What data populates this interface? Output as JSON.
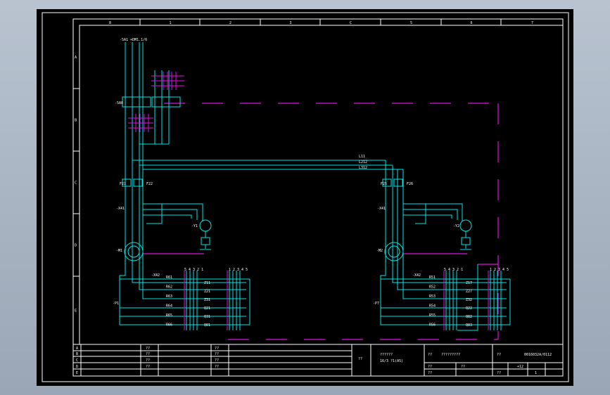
{
  "colors": {
    "background": "#000000",
    "frame": "#ffffff",
    "wire": "#00e5e5",
    "magenta": "#e010e0",
    "label": "#ffffff"
  },
  "column_markers": [
    "8",
    "1",
    "2",
    "3",
    "C",
    "5",
    "6",
    "7"
  ],
  "row_markers": [
    "A",
    "B",
    "C",
    "D",
    "E"
  ],
  "schematic": {
    "supply_ref": "-5A1 +DM1.1/6",
    "phase_labels": [
      "L1",
      "L2",
      "L3"
    ],
    "switch_ref": "-5A0",
    "switch_contacts": [
      "1",
      "3",
      "5"
    ],
    "switch_row2": [
      "B7",
      "B1",
      "B1",
      "B2"
    ],
    "bus_labels": [
      "L11",
      "L212",
      "L312"
    ],
    "left_fuses": [
      "F21",
      "F22"
    ],
    "right_fuses": [
      "F25",
      "F26"
    ],
    "left_terminal": "-X41",
    "right_terminal": "-X41",
    "left_valve": "-Y1",
    "right_valve": "-Y2",
    "left_motor": "-M1",
    "right_motor": "-M2",
    "left_terminal_block": "-X42",
    "right_terminal_block": "-X42",
    "left_block_numbers": "5 4 3 2 1",
    "right_block_numbers": "5 4 3 2 1",
    "left_block2_numbers": "1 2 3 4 5",
    "right_block2_numbers": "1 2 3 4 5",
    "left_R_labels": [
      "R61",
      "R62",
      "R63",
      "R64",
      "R65",
      "R66"
    ],
    "right_R_labels": [
      "R51",
      "R52",
      "R53",
      "R54",
      "R55",
      "R56"
    ],
    "left_Z_labels": [
      "Z11",
      "Z21",
      "Z31",
      "Q21",
      "Q31",
      "Q81"
    ],
    "right_Z_labels": [
      "Z17",
      "Z27",
      "Z32",
      "Q22",
      "Q82",
      "Q83"
    ],
    "left_group_ref": "-P1",
    "right_group_ref": "-P7"
  },
  "title_block": {
    "rows": [
      "A",
      "B",
      "C",
      "D",
      "E"
    ],
    "qq": "??",
    "title_line1": "??????",
    "title_line2": "16/3 ?1(A5)",
    "desc": "?????????",
    "drawing_no": "0016032A/0112",
    "sheet_field": "+12",
    "sheet_num": "1"
  }
}
